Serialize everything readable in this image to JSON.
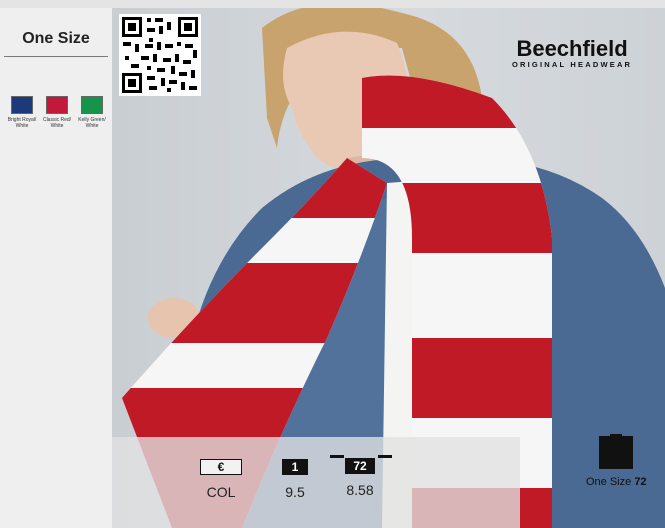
{
  "size_panel": {
    "label": "One Size",
    "swatches": [
      {
        "name": "Bright Royal/ White",
        "color": "#1c3a7a"
      },
      {
        "name": "Classic Red/ White",
        "color": "#c4183a"
      },
      {
        "name": "Kelly Green/ White",
        "color": "#169447"
      }
    ]
  },
  "brand": {
    "name": "Beechfield",
    "tagline": "ORIGINAL HEADWEAR",
    "trademark": "®"
  },
  "specs": {
    "currency": {
      "icon_label": "€",
      "value": "COL"
    },
    "pack": {
      "icon_label": "1",
      "value": "9.5"
    },
    "carton": {
      "icon_label": "72",
      "value": "8.58"
    },
    "box": {
      "size_label": "One Size",
      "quantity": "72"
    }
  },
  "colors": {
    "scarf_red": "#c01a26",
    "scarf_white": "#f6f6f6",
    "denim": "#4a6a93"
  }
}
